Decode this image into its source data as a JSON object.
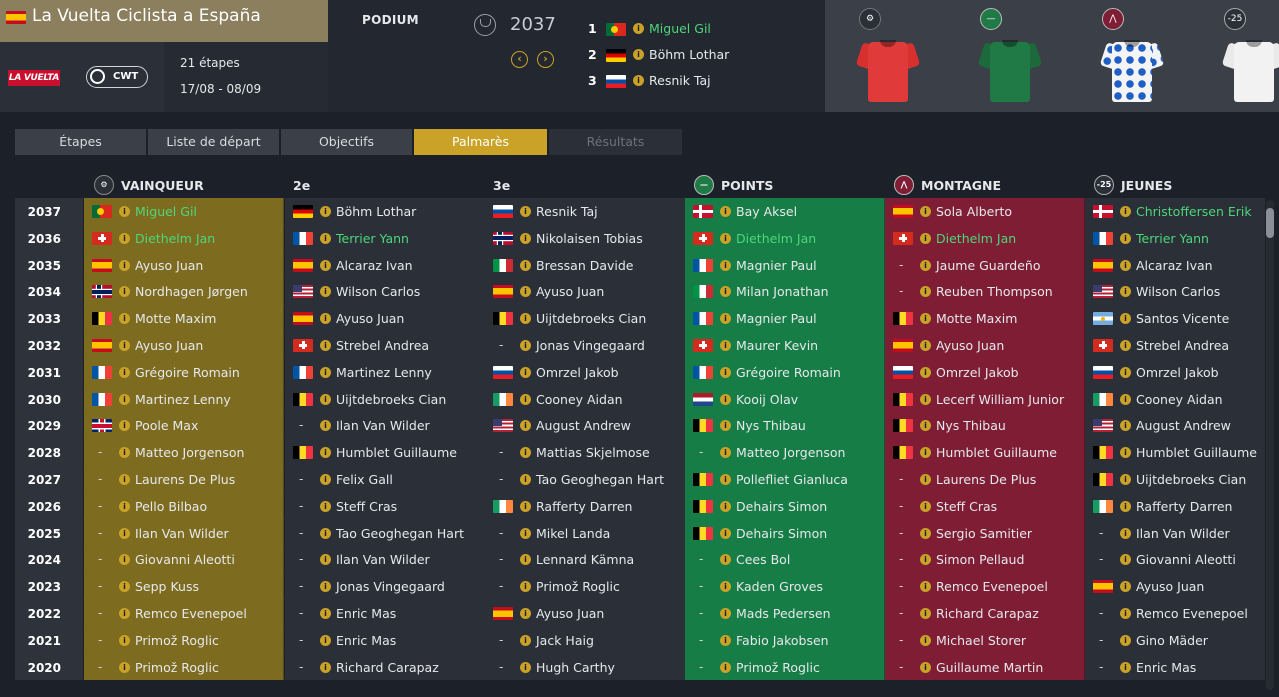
{
  "race": {
    "title": "La Vuelta Ciclista a España",
    "flag": "es",
    "stages": "21 étapes",
    "dates": "17/08 - 08/09",
    "logo_vuelta": "LA VUELTA",
    "logo_cwt": "CWT"
  },
  "podium": {
    "label": "PODIUM",
    "year": "2037",
    "entries": [
      {
        "rank": "1",
        "flag": "pt",
        "name": "Miguel Gil",
        "highlight": true
      },
      {
        "rank": "2",
        "flag": "de",
        "name": "Böhm Lothar",
        "highlight": false
      },
      {
        "rank": "3",
        "flag": "si",
        "name": "Resnik Taj",
        "highlight": false
      }
    ]
  },
  "jerseys": [
    {
      "icon": "general-classification-icon",
      "color": "#e03a3a"
    },
    {
      "icon": "points-icon",
      "color": "#1f7a45"
    },
    {
      "icon": "mountain-icon",
      "color": "#f4f4f4"
    },
    {
      "icon": "youth-icon",
      "color": "#f2f2f2",
      "label": "-25"
    }
  ],
  "tabs": [
    {
      "label": "Étapes",
      "state": "normal"
    },
    {
      "label": "Liste de départ",
      "state": "normal"
    },
    {
      "label": "Objectifs",
      "state": "normal"
    },
    {
      "label": "Palmarès",
      "state": "active"
    },
    {
      "label": "Résultats",
      "state": "disabled"
    }
  ],
  "columns": {
    "winner": "VAINQUEUR",
    "second": "2e",
    "third": "3e",
    "points": "POINTS",
    "mountain": "MONTAGNE",
    "youth": "JEUNES",
    "youth_icon_label": "-25"
  },
  "rows": [
    {
      "year": "2037",
      "cells": [
        [
          "pt",
          "Miguel Gil",
          1
        ],
        [
          "de",
          "Böhm Lothar",
          0
        ],
        [
          "si",
          "Resnik Taj",
          0
        ],
        [
          "dk",
          "Bay Aksel",
          0
        ],
        [
          "es",
          "Sola Alberto",
          0
        ],
        [
          "dk",
          "Christoffersen Erik",
          1
        ]
      ]
    },
    {
      "year": "2036",
      "cells": [
        [
          "ch",
          "Diethelm Jan",
          1
        ],
        [
          "fr",
          "Terrier Yann",
          1
        ],
        [
          "no",
          "Nikolaisen Tobias",
          0
        ],
        [
          "ch",
          "Diethelm Jan",
          1
        ],
        [
          "ch",
          "Diethelm Jan",
          1
        ],
        [
          "fr",
          "Terrier Yann",
          1
        ]
      ]
    },
    {
      "year": "2035",
      "cells": [
        [
          "es",
          "Ayuso Juan",
          0
        ],
        [
          "es",
          "Alcaraz Ivan",
          0
        ],
        [
          "it",
          "Bressan Davide",
          0
        ],
        [
          "fr",
          "Magnier Paul",
          0
        ],
        [
          "-",
          "Jaume Guardeño",
          0
        ],
        [
          "es",
          "Alcaraz Ivan",
          0
        ]
      ]
    },
    {
      "year": "2034",
      "cells": [
        [
          "no",
          "Nordhagen Jørgen",
          0
        ],
        [
          "us",
          "Wilson Carlos",
          0
        ],
        [
          "es",
          "Ayuso Juan",
          0
        ],
        [
          "it",
          "Milan Jonathan",
          0
        ],
        [
          "-",
          "Reuben Thompson",
          0
        ],
        [
          "us",
          "Wilson Carlos",
          0
        ]
      ]
    },
    {
      "year": "2033",
      "cells": [
        [
          "be",
          "Motte Maxim",
          0
        ],
        [
          "es",
          "Ayuso Juan",
          0
        ],
        [
          "be",
          "Uijtdebroeks Cian",
          0
        ],
        [
          "fr",
          "Magnier Paul",
          0
        ],
        [
          "be",
          "Motte Maxim",
          0
        ],
        [
          "ar",
          "Santos Vicente",
          0
        ]
      ]
    },
    {
      "year": "2032",
      "cells": [
        [
          "es",
          "Ayuso Juan",
          0
        ],
        [
          "ch",
          "Strebel Andrea",
          0
        ],
        [
          "-",
          "Jonas Vingegaard",
          0
        ],
        [
          "ch",
          "Maurer Kevin",
          0
        ],
        [
          "es",
          "Ayuso Juan",
          0
        ],
        [
          "ch",
          "Strebel Andrea",
          0
        ]
      ]
    },
    {
      "year": "2031",
      "cells": [
        [
          "fr",
          "Grégoire Romain",
          0
        ],
        [
          "fr",
          "Martinez Lenny",
          0
        ],
        [
          "si",
          "Omrzel Jakob",
          0
        ],
        [
          "fr",
          "Grégoire Romain",
          0
        ],
        [
          "si",
          "Omrzel Jakob",
          0
        ],
        [
          "si",
          "Omrzel Jakob",
          0
        ]
      ]
    },
    {
      "year": "2030",
      "cells": [
        [
          "fr",
          "Martinez Lenny",
          0
        ],
        [
          "be",
          "Uijtdebroeks Cian",
          0
        ],
        [
          "ie",
          "Cooney Aidan",
          0
        ],
        [
          "nl",
          "Kooij Olav",
          0
        ],
        [
          "be",
          "Lecerf William Junior",
          0
        ],
        [
          "ie",
          "Cooney Aidan",
          0
        ]
      ]
    },
    {
      "year": "2029",
      "cells": [
        [
          "gb",
          "Poole Max",
          0
        ],
        [
          "-",
          "Ilan Van Wilder",
          0
        ],
        [
          "us",
          "August Andrew",
          0
        ],
        [
          "be",
          "Nys Thibau",
          0
        ],
        [
          "be",
          "Nys Thibau",
          0
        ],
        [
          "us",
          "August Andrew",
          0
        ]
      ]
    },
    {
      "year": "2028",
      "cells": [
        [
          "-",
          "Matteo Jorgenson",
          0
        ],
        [
          "be",
          "Humblet Guillaume",
          0
        ],
        [
          "-",
          "Mattias Skjelmose",
          0
        ],
        [
          "-",
          "Matteo Jorgenson",
          0
        ],
        [
          "be",
          "Humblet Guillaume",
          0
        ],
        [
          "be",
          "Humblet Guillaume",
          0
        ]
      ]
    },
    {
      "year": "2027",
      "cells": [
        [
          "-",
          "Laurens De Plus",
          0
        ],
        [
          "-",
          "Felix Gall",
          0
        ],
        [
          "-",
          "Tao Geoghegan Hart",
          0
        ],
        [
          "be",
          "Pollefliet Gianluca",
          0
        ],
        [
          "-",
          "Laurens De Plus",
          0
        ],
        [
          "be",
          "Uijtdebroeks Cian",
          0
        ]
      ]
    },
    {
      "year": "2026",
      "cells": [
        [
          "-",
          "Pello Bilbao",
          0
        ],
        [
          "-",
          "Steff Cras",
          0
        ],
        [
          "ie",
          "Rafferty Darren",
          0
        ],
        [
          "be",
          "Dehairs Simon",
          0
        ],
        [
          "-",
          "Steff Cras",
          0
        ],
        [
          "ie",
          "Rafferty Darren",
          0
        ]
      ]
    },
    {
      "year": "2025",
      "cells": [
        [
          "-",
          "Ilan Van Wilder",
          0
        ],
        [
          "-",
          "Tao Geoghegan Hart",
          0
        ],
        [
          "-",
          "Mikel Landa",
          0
        ],
        [
          "be",
          "Dehairs Simon",
          0
        ],
        [
          "-",
          "Sergio Samitier",
          0
        ],
        [
          "-",
          "Ilan Van Wilder",
          0
        ]
      ]
    },
    {
      "year": "2024",
      "cells": [
        [
          "-",
          "Giovanni Aleotti",
          0
        ],
        [
          "-",
          "Ilan Van Wilder",
          0
        ],
        [
          "-",
          "Lennard Kämna",
          0
        ],
        [
          "-",
          "Cees Bol",
          0
        ],
        [
          "-",
          "Simon Pellaud",
          0
        ],
        [
          "-",
          "Giovanni Aleotti",
          0
        ]
      ]
    },
    {
      "year": "2023",
      "cells": [
        [
          "-",
          "Sepp Kuss",
          0
        ],
        [
          "-",
          "Jonas Vingegaard",
          0
        ],
        [
          "-",
          "Primož Roglic",
          0
        ],
        [
          "-",
          "Kaden Groves",
          0
        ],
        [
          "-",
          "Remco Evenepoel",
          0
        ],
        [
          "es",
          "Ayuso Juan",
          0
        ]
      ]
    },
    {
      "year": "2022",
      "cells": [
        [
          "-",
          "Remco Evenepoel",
          0
        ],
        [
          "-",
          "Enric Mas",
          0
        ],
        [
          "es",
          "Ayuso Juan",
          0
        ],
        [
          "-",
          "Mads Pedersen",
          0
        ],
        [
          "-",
          "Richard Carapaz",
          0
        ],
        [
          "-",
          "Remco Evenepoel",
          0
        ]
      ]
    },
    {
      "year": "2021",
      "cells": [
        [
          "-",
          "Primož Roglic",
          0
        ],
        [
          "-",
          "Enric Mas",
          0
        ],
        [
          "-",
          "Jack Haig",
          0
        ],
        [
          "-",
          "Fabio Jakobsen",
          0
        ],
        [
          "-",
          "Michael Storer",
          0
        ],
        [
          "-",
          "Gino Mäder",
          0
        ]
      ]
    },
    {
      "year": "2020",
      "cells": [
        [
          "-",
          "Primož Roglic",
          0
        ],
        [
          "-",
          "Richard Carapaz",
          0
        ],
        [
          "-",
          "Hugh Carthy",
          0
        ],
        [
          "-",
          "Primož Roglic",
          0
        ],
        [
          "-",
          "Guillaume Martin",
          0
        ],
        [
          "-",
          "Enric Mas",
          0
        ]
      ]
    }
  ]
}
